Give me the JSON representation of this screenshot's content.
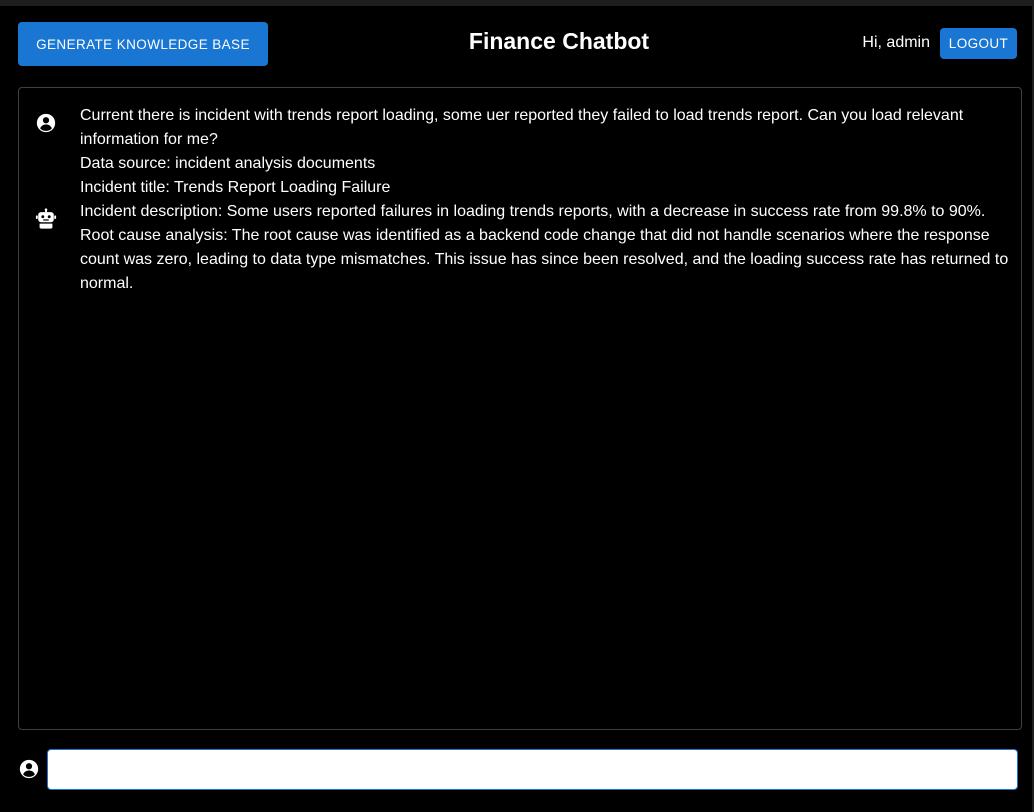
{
  "header": {
    "generate_kb_label": "GENERATE KNOWLEDGE BASE",
    "title": "Finance Chatbot",
    "greeting": "Hi, admin",
    "logout_label": "LOGOUT"
  },
  "messages": [
    {
      "role": "user",
      "icon": "user-circle-icon",
      "lines": [
        "Current there is incident with trends report loading, some uer reported they failed to load trends report. Can you load relevant information for me?",
        "Data source: incident analysis documents",
        "Incident title: Trends Report Loading Failure"
      ]
    },
    {
      "role": "bot",
      "icon": "robot-icon",
      "lines": [
        "Incident description: Some users reported failures in loading trends reports, with a decrease in success rate from 99.8% to 90%.",
        "Root cause analysis: The root cause was identified as a backend code change that did not handle scenarios where the response count was zero, leading to data type mismatches. This issue has since been resolved, and the loading success rate has returned to normal."
      ]
    }
  ],
  "input": {
    "icon": "user-circle-icon",
    "value": "",
    "placeholder": ""
  },
  "colors": {
    "accent": "#1976d2",
    "background": "#000000",
    "panel_border": "#3f3f3f",
    "text": "#ffffff"
  }
}
